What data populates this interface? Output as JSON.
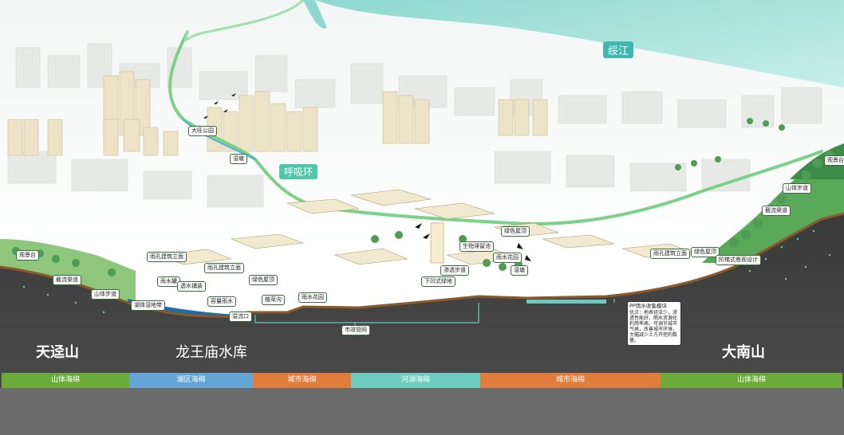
{
  "river_name": "绥江",
  "ring_name": "呼吸环",
  "mountain_left": "天迳山",
  "reservoir": "龙王庙水库",
  "mountain_right": "大南山",
  "labels": {
    "park": "大旺公园",
    "wetland": "湿塘",
    "observe_left": "观景台",
    "drain_channel": "截流渠道",
    "mountain_path_left": "山体步道",
    "wetland_bird": "湖体湿地带",
    "porous_facade_1": "雨孔建筑立面",
    "rain_pond": "雨水罐",
    "seep_shelf": "透水铺装",
    "rain_garden": "容量雨水",
    "porous_facade_2": "雨孔建筑立面",
    "green_roof_1": "绿色屋顶",
    "grass_ditch": "植草沟",
    "rain_garden_2": "雨水花园",
    "outlet": "溢流口",
    "pipe": "市政管网",
    "bio_swale": "生物滞留池",
    "green_roof_2": "绿色屋顶",
    "rain_garden_3": "雨水花园",
    "seep_walk": "渗透步道",
    "sink_green": "下凹式绿地",
    "wetland_2": "湿塘",
    "porous_facade_3": "雨孔建筑立面",
    "green_roof_3": "绿色屋顶",
    "observe_right": "观景台",
    "mountain_path_right": "山体步道",
    "drain_channel_2": "截流渠道",
    "step_design": "阶梯式景观设计"
  },
  "note": {
    "title": "PP雨水收集模块",
    "body": "优点：地表径流少，渗透性能好，雨水资源化利用率高，可调节城市气候，改善城市环境，大幅减少土方开挖的数量。"
  },
  "bands": [
    {
      "label": "山体海绵",
      "color": "#6aab3a"
    },
    {
      "label": "湖区海绵",
      "color": "#63a5d4"
    },
    {
      "label": "城市海绵",
      "color": "#e07c3c"
    },
    {
      "label": "河湖海绵",
      "color": "#6ccdbf"
    },
    {
      "label": "城市海绵",
      "color": "#e07c3c"
    },
    {
      "label": "山体海绵",
      "color": "#6aab3a"
    }
  ]
}
